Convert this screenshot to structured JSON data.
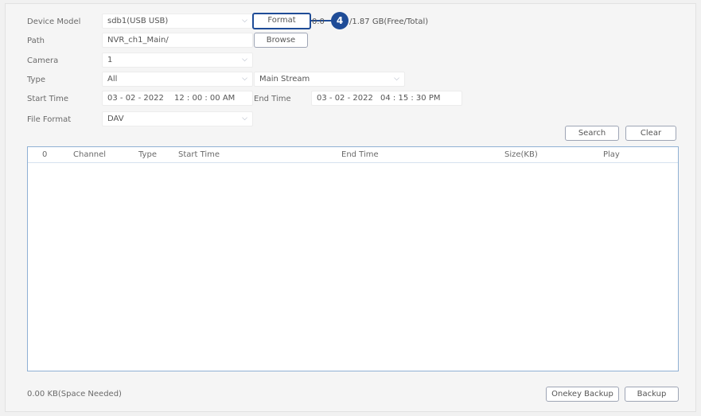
{
  "form": {
    "device_model": {
      "label": "Device Model",
      "value": "sdb1(USB USB)"
    },
    "format_button": "Format",
    "capacity_prefix": "0.0",
    "capacity_suffix": "/1.87 GB(Free/Total)",
    "callout_number": "4",
    "path": {
      "label": "Path",
      "value": "NVR_ch1_Main/"
    },
    "browse_button": "Browse",
    "camera": {
      "label": "Camera",
      "value": "1"
    },
    "type": {
      "label": "Type",
      "value": "All"
    },
    "stream": {
      "value": "Main Stream"
    },
    "start_time": {
      "label": "Start Time",
      "date": "03 - 02 - 2022",
      "time": "12 : 00 : 00 AM"
    },
    "end_time": {
      "label": "End Time",
      "date": "03 - 02 - 2022",
      "time": "04 : 15 : 30 PM"
    },
    "file_format": {
      "label": "File Format",
      "value": "DAV"
    },
    "search_button": "Search",
    "clear_button": "Clear"
  },
  "table": {
    "columns": [
      "0",
      "Channel",
      "Type",
      "Start Time",
      "End Time",
      "Size(KB)",
      "Play"
    ],
    "rows": []
  },
  "footer": {
    "space_needed": "0.00 KB(Space Needed)",
    "onekey_backup_button": "Onekey Backup",
    "backup_button": "Backup"
  },
  "icons": {
    "dropdown": "chevron-down-icon"
  },
  "colors": {
    "accent": "#1f4c97",
    "table_border": "#8fb0d4",
    "background": "#f5f5f5"
  }
}
